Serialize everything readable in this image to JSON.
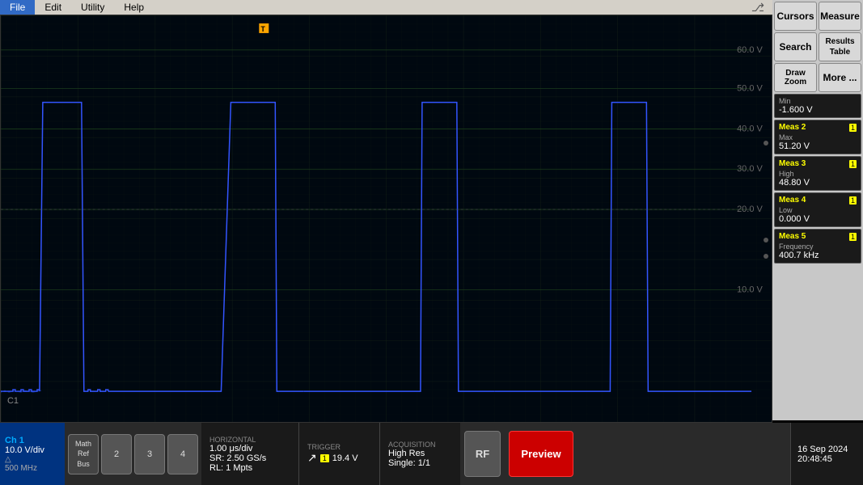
{
  "menu": {
    "items": [
      "File",
      "Edit",
      "Utility",
      "Help"
    ]
  },
  "scope": {
    "y_labels": [
      "60.0 V",
      "50.0 V",
      "40.0 V",
      "30.0 V",
      "20.0 V",
      "10.0 V"
    ],
    "y_positions": [
      8,
      18,
      31,
      44,
      57,
      70
    ],
    "c1_label": "C1"
  },
  "right_panel": {
    "btn1": "Cursors",
    "btn2": "Measure",
    "btn3": "Search",
    "btn4": "Results\nTable",
    "btn5": "Draw\nZoom",
    "btn6": "More ...",
    "min_label": "Min",
    "min_value": "-1.600 V",
    "meas": [
      {
        "title": "Meas 2",
        "ch": "1",
        "label": "Max",
        "value": "51.20 V"
      },
      {
        "title": "Meas 3",
        "ch": "1",
        "label": "High",
        "value": "48.80 V"
      },
      {
        "title": "Meas 4",
        "ch": "1",
        "label": "Low",
        "value": "0.000 V"
      },
      {
        "title": "Meas 5",
        "ch": "1",
        "label": "Frequency",
        "value": "400.7 kHz"
      }
    ]
  },
  "ch1": {
    "label": "Ch 1",
    "vdiv": "10.0 V/div",
    "sub1": "△",
    "mhz": "500 MHz"
  },
  "bottom_btns": {
    "num2": "2",
    "num3": "3",
    "num4": "4",
    "math": "Math\nRef\nBus"
  },
  "horizontal": {
    "title": "Horizontal",
    "val1": "1.00 μs/div",
    "val2": "SR: 2.50 GS/s",
    "val3": "RL: 1 Mpts"
  },
  "trigger": {
    "title": "Trigger",
    "ch": "1",
    "arrow": "↗",
    "value": "19.4 V"
  },
  "acquisition": {
    "title": "Acquisition",
    "val1": "High Res",
    "val2": "Single: 1/1"
  },
  "rf_btn": "RF",
  "preview_btn": "Preview",
  "datetime": {
    "date": "16 Sep 2024",
    "time": "20:48:45"
  }
}
